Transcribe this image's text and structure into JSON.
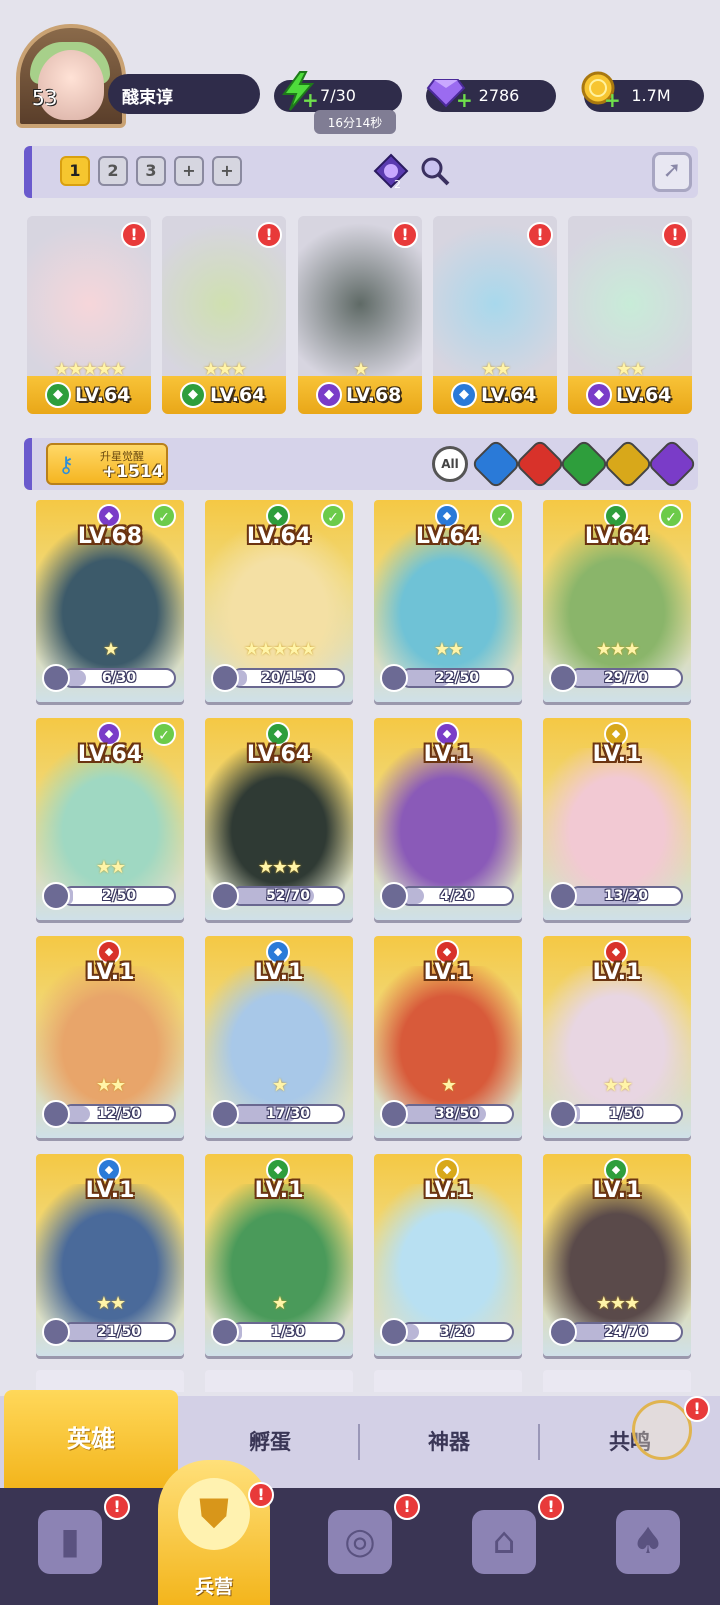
{
  "player": {
    "level": "53",
    "name": "醆束谆"
  },
  "resources": {
    "energy": "7/30",
    "energy_timer": "16分14秒",
    "gems": "2786",
    "gold": "1.7M"
  },
  "team_bar": {
    "slots": [
      "1",
      "2",
      "3",
      "+",
      "+"
    ],
    "active_slot": "1",
    "badge_count": "2"
  },
  "team": [
    {
      "level": "LV.64",
      "element": "green",
      "stars": "★★★★★",
      "alert": true
    },
    {
      "level": "LV.64",
      "element": "green",
      "stars": "★★★",
      "alert": true
    },
    {
      "level": "LV.68",
      "element": "purple",
      "stars": "★",
      "alert": true
    },
    {
      "level": "LV.64",
      "element": "blue",
      "stars": "★★",
      "alert": true
    },
    {
      "level": "LV.64",
      "element": "purple",
      "stars": "★★",
      "alert": true
    }
  ],
  "filter_bar": {
    "awaken_label": "升星觉醒",
    "awaken_value": "+1514",
    "all_label": "All"
  },
  "heroes": [
    {
      "level": "LV.68",
      "element": "purple",
      "check": true,
      "stars": "★",
      "shards": "6/30",
      "fill": 0.2,
      "art": "#3c5a6a"
    },
    {
      "level": "LV.64",
      "element": "green",
      "check": true,
      "stars": "★★★★★",
      "shards": "20/150",
      "fill": 0.13,
      "art": "#f4e0a4"
    },
    {
      "level": "LV.64",
      "element": "blue",
      "check": true,
      "stars": "★★",
      "shards": "22/50",
      "fill": 0.44,
      "art": "#6fc2d6"
    },
    {
      "level": "LV.64",
      "element": "green",
      "check": true,
      "stars": "★★★",
      "shards": "29/70",
      "fill": 0.41,
      "art": "#8ab56a"
    },
    {
      "level": "LV.64",
      "element": "purple",
      "check": true,
      "stars": "★★",
      "shards": "2/50",
      "fill": 0.04,
      "art": "#9fd8c2"
    },
    {
      "level": "LV.64",
      "element": "green",
      "check": false,
      "stars": "★★★",
      "shards": "52/70",
      "fill": 0.74,
      "art": "#2f3a34"
    },
    {
      "level": "LV.1",
      "element": "purple",
      "check": false,
      "stars": "",
      "shards": "4/20",
      "fill": 0.2,
      "art": "#8a5ab8"
    },
    {
      "level": "LV.1",
      "element": "light",
      "check": false,
      "stars": "",
      "shards": "13/20",
      "fill": 0.65,
      "art": "#f2c9d3"
    },
    {
      "level": "LV.1",
      "element": "red",
      "check": false,
      "stars": "★★",
      "shards": "12/50",
      "fill": 0.24,
      "art": "#e8a56a"
    },
    {
      "level": "LV.1",
      "element": "blue",
      "check": false,
      "stars": "★",
      "shards": "17/30",
      "fill": 0.57,
      "art": "#a8c8e8"
    },
    {
      "level": "LV.1",
      "element": "red",
      "check": false,
      "stars": "★",
      "shards": "38/50",
      "fill": 0.76,
      "art": "#d85a3a"
    },
    {
      "level": "LV.1",
      "element": "red",
      "check": false,
      "stars": "★★",
      "shards": "1/50",
      "fill": 0.02,
      "art": "#e8d6e2"
    },
    {
      "level": "LV.1",
      "element": "blue",
      "check": false,
      "stars": "★★",
      "shards": "21/50",
      "fill": 0.42,
      "art": "#4a6a9a"
    },
    {
      "level": "LV.1",
      "element": "green",
      "check": false,
      "stars": "★",
      "shards": "1/30",
      "fill": 0.03,
      "art": "#4a9a5a"
    },
    {
      "level": "LV.1",
      "element": "light",
      "check": false,
      "stars": "",
      "shards": "3/20",
      "fill": 0.15,
      "art": "#b8e0f2"
    },
    {
      "level": "LV.1",
      "element": "green",
      "check": false,
      "stars": "★★★",
      "shards": "24/70",
      "fill": 0.34,
      "art": "#5a4a4a"
    }
  ],
  "subtabs": {
    "heroes": "英雄",
    "hatch": "孵蛋",
    "artifacts": "神器",
    "resonance": "共鸣"
  },
  "nav": {
    "barracks": "兵营"
  },
  "colors": {
    "green": "#2e9e3c",
    "purple": "#7a3cc8",
    "blue": "#2a7ad8",
    "red": "#d8322a",
    "light": "#d8a81a",
    "accent_gold": "#f3b51c",
    "panel": "#d6d3ea"
  }
}
